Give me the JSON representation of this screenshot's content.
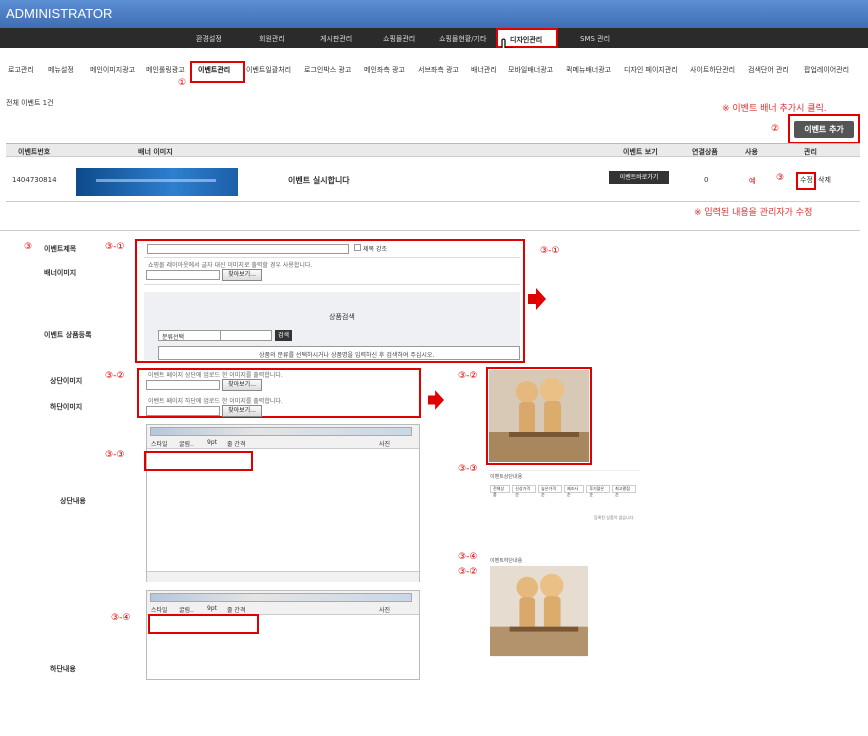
{
  "header": {
    "title": "ADMINISTRATOR"
  },
  "topnav": [
    {
      "label": "환경설정"
    },
    {
      "label": "회원관리"
    },
    {
      "label": "게시판관리"
    },
    {
      "label": "쇼핑몰관리"
    },
    {
      "label": "쇼핑몰현황/기타"
    },
    {
      "label": "디자인관리"
    },
    {
      "label": "SMS 관리"
    }
  ],
  "subnav": [
    {
      "label": "로고관리"
    },
    {
      "label": "메뉴설정"
    },
    {
      "label": "메인이미지광고"
    },
    {
      "label": "메인롤링광고"
    },
    {
      "label": "이벤트관리"
    },
    {
      "label": "이벤트일괄처리"
    },
    {
      "label": "로그인박스 광고"
    },
    {
      "label": "메인좌측 광고"
    },
    {
      "label": "서브좌측 광고"
    },
    {
      "label": "배너관리"
    },
    {
      "label": "모바일배너광고"
    },
    {
      "label": "퀵메뉴배너광고"
    },
    {
      "label": "디자인 페이지관리"
    },
    {
      "label": "사이트하단관리"
    },
    {
      "label": "검색단어 관리"
    },
    {
      "label": "팝업레이어관리"
    }
  ],
  "total_label": "전체 이벤트 1건",
  "notes": {
    "add": "※ 이벤트 배너 추가시 클릭.",
    "edit": "※ 입력된 내용을 관리자가 수정"
  },
  "add_button": "이벤트 추가",
  "table": {
    "headers": [
      "이벤트번호",
      "배너 이미지",
      "이벤트 보기",
      "연결상품",
      "사용",
      "관리"
    ],
    "row": {
      "id": "1404730814",
      "title": "이벤트 실시합니다",
      "view_button": "이벤트바로가기",
      "products": "0",
      "use": "예",
      "edit": "수정",
      "delete": "삭제"
    }
  },
  "markers": {
    "m1": "①",
    "m2": "②",
    "m3": "③",
    "m3_1": "③-①",
    "m3_2": "③-②",
    "m3_3": "③-③",
    "m3_4": "③-④"
  },
  "form": {
    "event_title": "이벤트제목",
    "title_bold": "제목 강조",
    "banner_image": "배너이미지",
    "banner_hint": "쇼핑몰 레이아웃에서 글자 대신 이미지로 출력할 경우 사용합니다.",
    "browse": "찾아보기...",
    "product_reg": "이벤트 상품등록",
    "product_search": "상품검색",
    "category_select": "분류선택",
    "search_btn": "검색",
    "search_hint": "상품의 분류를 선택하시거나 상품명을 입력하신 후 검색하여 주십시오.",
    "top_image": "상단이미지",
    "top_hint": "이벤트 페이지 상단에 업로드 한 이미지를 출력합니다.",
    "bottom_image": "하단이미지",
    "bottom_hint": "이벤트 페이지 하단에 업로드 한 이미지를 출력합니다.",
    "top_content": "상단내용",
    "bottom_content": "하단내용",
    "toolbar": {
      "style": "스타일",
      "font": "굴림..",
      "size": "9pt",
      "spacing": "줄 간격",
      "photo": "사진"
    }
  },
  "preview": {
    "top_content_text": "이벤트상단내용",
    "bottom_content_text": "이벤트하단내용",
    "no_products": "등록된 상품이 없습니다.",
    "tabs": [
      "전체상품",
      "신상가격순",
      "높은가격순",
      "제조사순",
      "후기많은순",
      "최고평점순"
    ]
  },
  "colors": {
    "header_bg": "#4a7cc0",
    "nav_bg": "#2b2b2b",
    "red": "#e00000",
    "button_dark": "#555555"
  }
}
